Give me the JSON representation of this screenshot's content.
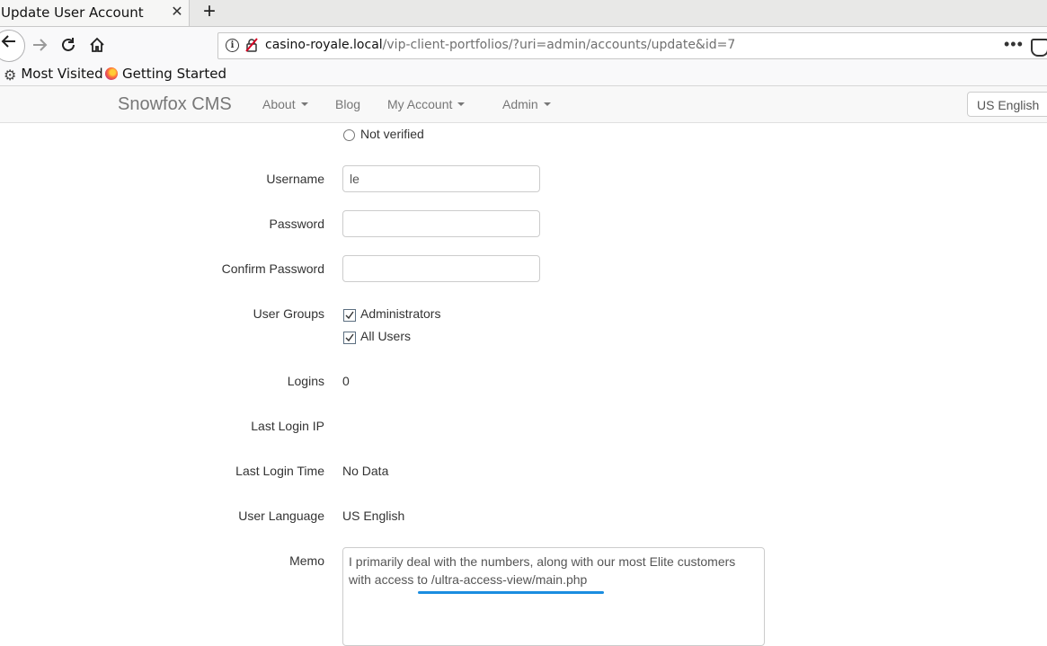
{
  "browser": {
    "tab_title": "Update User Account",
    "tab_close_glyph": "✕",
    "new_tab_glyph": "+",
    "url_host": "casino-royale.local",
    "url_path": "/vip-client-portfolios/?uri=admin/accounts/update&id=7",
    "page_actions_glyph": "•••",
    "bookmarks": [
      {
        "label": "Most Visited",
        "icon": "gear-icon"
      },
      {
        "label": "Getting Started",
        "icon": "firefox-icon"
      }
    ]
  },
  "site": {
    "brand": "Snowfox CMS",
    "nav": {
      "about": "About",
      "blog": "Blog",
      "my_account": "My Account",
      "admin": "Admin"
    },
    "language_select": "US English"
  },
  "form": {
    "not_verified_label": "Not verified",
    "username_label": "Username",
    "username_value": "le",
    "password_label": "Password",
    "confirm_password_label": "Confirm Password",
    "user_groups_label": "User Groups",
    "groups": [
      {
        "label": "Administrators",
        "checked": true
      },
      {
        "label": "All Users",
        "checked": true
      }
    ],
    "logins_label": "Logins",
    "logins_value": "0",
    "last_login_ip_label": "Last Login IP",
    "last_login_ip_value": "",
    "last_login_time_label": "Last Login Time",
    "last_login_time_value": "No Data",
    "user_language_label": "User Language",
    "user_language_value": "US English",
    "memo_label": "Memo",
    "memo_value": "I primarily deal with the numbers, along with our most Elite customers with access to /ultra-access-view/main.php"
  },
  "colors": {
    "annotation_underline": "#1a8de0",
    "nav_text": "#777777"
  }
}
